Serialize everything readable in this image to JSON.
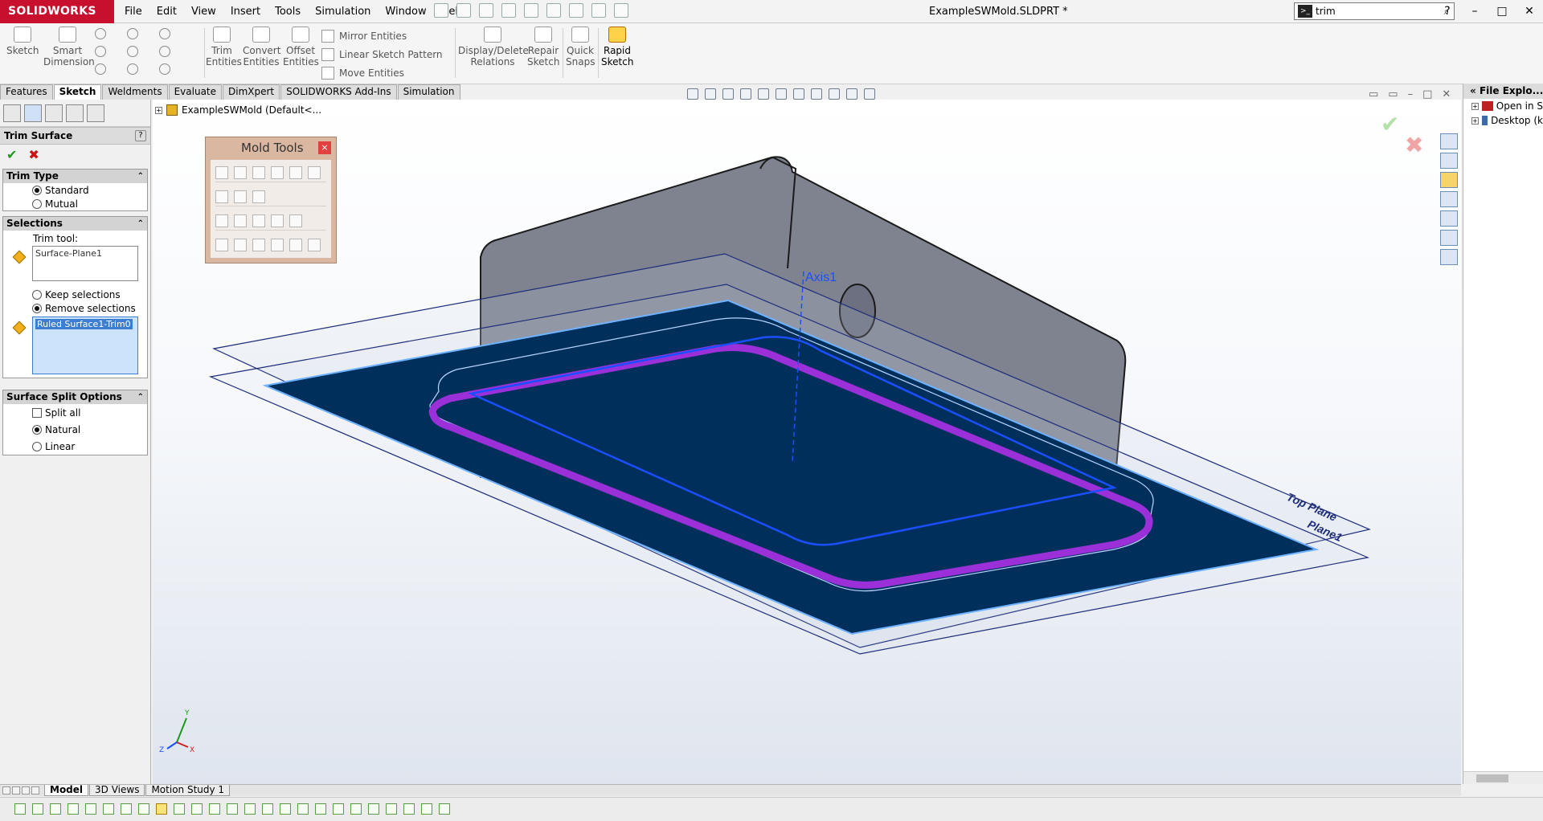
{
  "app": {
    "name": "SOLIDWORKS",
    "document_title": "ExampleSWMold.SLDPRT *"
  },
  "menu": [
    "File",
    "Edit",
    "View",
    "Insert",
    "Tools",
    "Simulation",
    "Window",
    "Help"
  ],
  "search": {
    "value": "trim"
  },
  "window_buttons": [
    "?",
    "–",
    "□",
    "✕"
  ],
  "ribbon": {
    "sketch": "Sketch",
    "smart_dimension_1": "Smart",
    "smart_dimension_2": "Dimension",
    "trim_1": "Trim",
    "trim_2": "Entities",
    "convert_1": "Convert",
    "convert_2": "Entities",
    "offset_1": "Offset",
    "offset_2": "Entities",
    "mirror": "Mirror Entities",
    "linear_pattern": "Linear Sketch Pattern",
    "move": "Move Entities",
    "display_delete_1": "Display/Delete",
    "display_delete_2": "Relations",
    "repair_1": "Repair",
    "repair_2": "Sketch",
    "quick_snaps_1": "Quick",
    "quick_snaps_2": "Snaps",
    "rapid_sketch_1": "Rapid",
    "rapid_sketch_2": "Sketch"
  },
  "tabs": [
    {
      "label": "Features",
      "active": false
    },
    {
      "label": "Sketch",
      "active": true
    },
    {
      "label": "Weldments",
      "active": false
    },
    {
      "label": "Evaluate",
      "active": false
    },
    {
      "label": "DimXpert",
      "active": false
    },
    {
      "label": "SOLIDWORKS Add-Ins",
      "active": false
    },
    {
      "label": "Simulation",
      "active": false
    }
  ],
  "property_manager": {
    "title": "Trim Surface",
    "help": "?",
    "ok": "✔",
    "cancel": "✖",
    "trim_type": {
      "header": "Trim Type",
      "options": [
        "Standard",
        "Mutual"
      ],
      "selected": "Standard"
    },
    "selections": {
      "header": "Selections",
      "trim_tool_label": "Trim tool:",
      "trim_tool_value": "Surface-Plane1",
      "keep_label": "Keep selections",
      "remove_label": "Remove selections",
      "selected": "Remove selections",
      "pieces_value": "Ruled Surface1-Trim0"
    },
    "split_options": {
      "header": "Surface Split Options",
      "split_all": "Split all",
      "natural": "Natural",
      "linear": "Linear",
      "selected": "Natural"
    }
  },
  "feature_tree": {
    "root": "ExampleSWMold  (Default<..."
  },
  "mold_tools": {
    "title": "Mold Tools",
    "close": "×"
  },
  "viewport": {
    "axis_label": "Axis1",
    "plane_labels": [
      "Top Plane",
      "Plane1"
    ],
    "triad": {
      "x": "X",
      "y": "Y",
      "z": "Z"
    }
  },
  "task_pane": {
    "title": "File Explo...",
    "items": [
      "Open in S",
      "Desktop (k"
    ]
  },
  "bottom_tabs": [
    {
      "label": "Model",
      "active": true
    },
    {
      "label": "3D Views",
      "active": false
    },
    {
      "label": "Motion Study 1",
      "active": false
    }
  ],
  "colors": {
    "brand": "#c8102e",
    "surface_fill": "#002f5c",
    "highlight_edge": "#8a2be2",
    "selection_edge": "#1a4fff"
  }
}
